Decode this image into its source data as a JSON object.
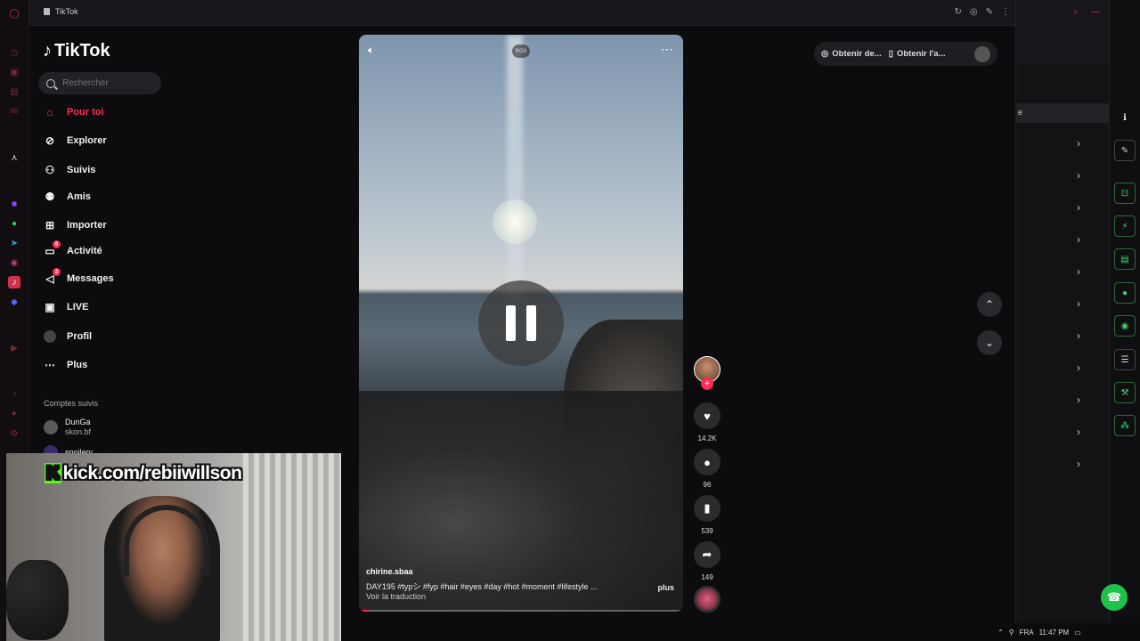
{
  "browser": {
    "tab_title": "TikTok"
  },
  "tiktok": {
    "logo": "TikTok",
    "search": {
      "placeholder": "Rechercher"
    },
    "nav": [
      {
        "label": "Pour toi",
        "icon": "home-icon",
        "active": true
      },
      {
        "label": "Explorer",
        "icon": "compass-icon"
      },
      {
        "label": "Suivis",
        "icon": "following-icon"
      },
      {
        "label": "Amis",
        "icon": "friends-icon"
      },
      {
        "label": "Importer",
        "icon": "upload-icon"
      },
      {
        "label": "Activité",
        "icon": "activity-icon",
        "badge": "9"
      },
      {
        "label": "Messages",
        "icon": "messages-icon",
        "badge": "2"
      },
      {
        "label": "LIVE",
        "icon": "live-icon"
      },
      {
        "label": "Profil",
        "icon": "profile-icon"
      },
      {
        "label": "Plus",
        "icon": "more-icon"
      }
    ],
    "following_section": "Comptes suivis",
    "accounts": [
      {
        "name": "DunGa",
        "handle": "skon.bf"
      },
      {
        "name": "spoilerv",
        "handle": ""
      }
    ]
  },
  "video": {
    "badge": "RGX",
    "author": "chirine.sbaa",
    "description": "DAY195 #typシ #fyp #hair #eyes #day #hot #moment #lifestyle ...",
    "more_label": "plus",
    "translate": "Voir la traduction",
    "progress": 0.03,
    "likes": "14.2K",
    "comments": "96",
    "saves": "539",
    "shares": "149"
  },
  "top_actions": {
    "get_coins": "Obtenir de...",
    "get_app": "Obtenir l'a..."
  },
  "overlay": {
    "kick_url": "kick.com/rebiiwillson"
  },
  "taskbar": {
    "lang": "FRA",
    "time": "11:47 PM"
  },
  "colors": {
    "accent": "#fe2c55",
    "kick": "#53fc18",
    "opera": "#d0324e"
  }
}
